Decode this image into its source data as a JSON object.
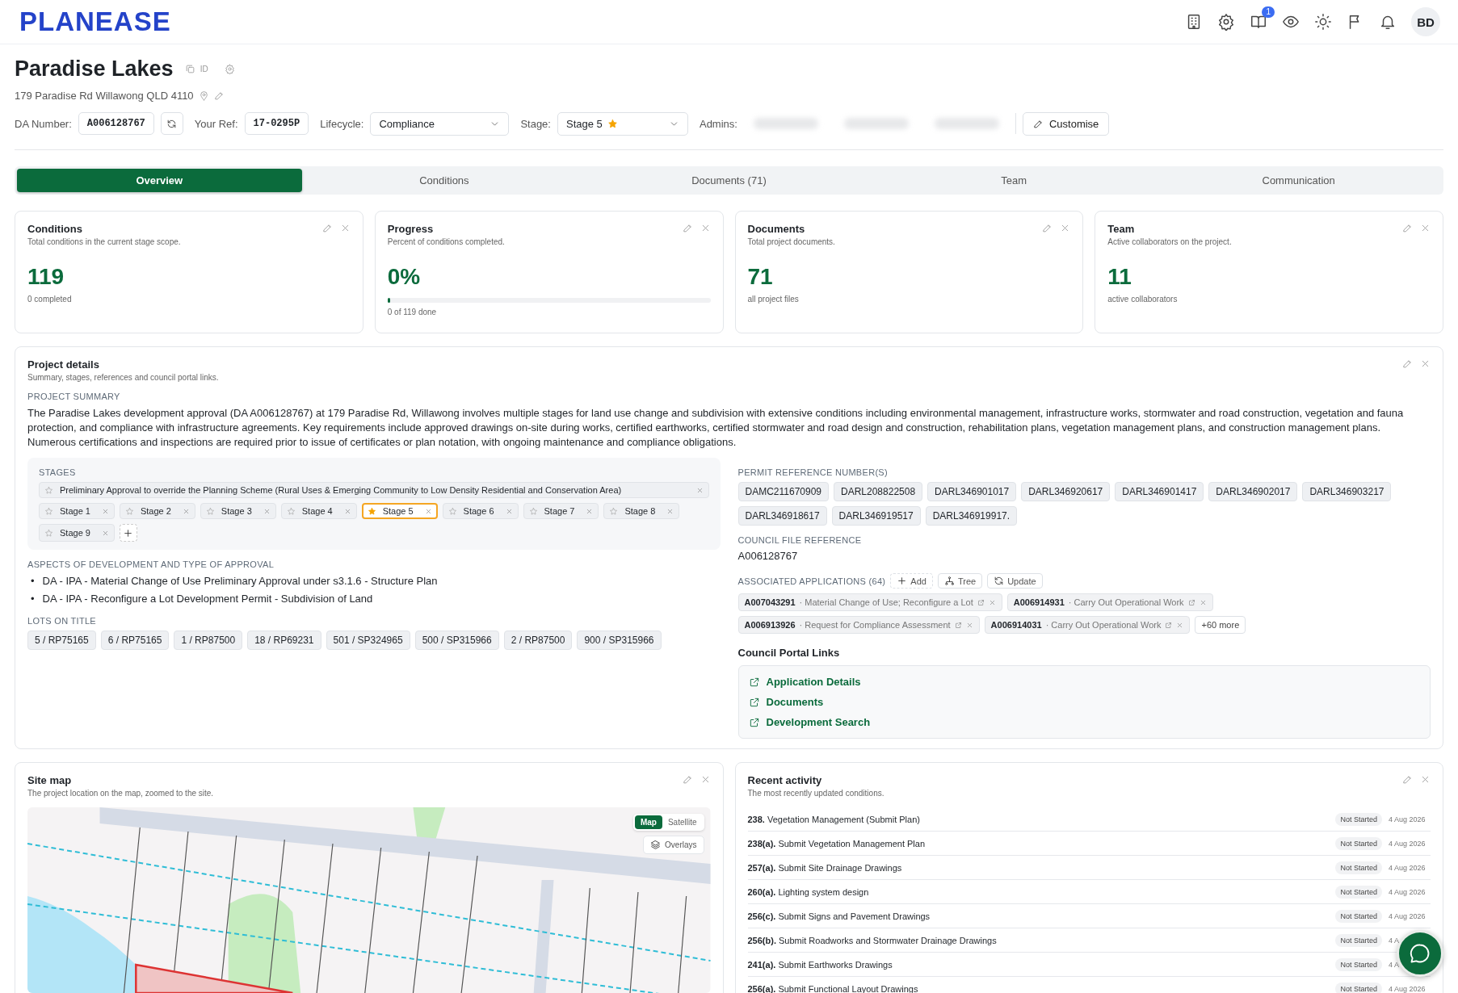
{
  "header": {
    "logo": "PLANEASE",
    "icons": [
      {
        "kind": "building"
      },
      {
        "kind": "settings"
      },
      {
        "kind": "book",
        "badge": "1"
      },
      {
        "kind": "eye"
      },
      {
        "kind": "sun"
      },
      {
        "kind": "flag"
      },
      {
        "kind": "bell"
      }
    ],
    "avatar": "BD"
  },
  "project": {
    "title": "Paradise Lakes",
    "id_label": "ID",
    "address": "179 Paradise Rd Willawong QLD 4110"
  },
  "toolbar": {
    "da_label": "DA Number:",
    "da_value": "A006128767",
    "ref_label": "Your Ref:",
    "ref_value": "17-0295P",
    "lifecycle_label": "Lifecycle:",
    "lifecycle_value": "Compliance",
    "stage_label": "Stage:",
    "stage_value": "Stage 5",
    "admins_label": "Admins:",
    "admins": [
      {
        "kind": "redacted"
      },
      {
        "kind": "redacted"
      },
      {
        "kind": "redacted"
      }
    ],
    "customise": "Customise"
  },
  "tabs": [
    {
      "label": "Overview",
      "selected": true
    },
    {
      "label": "Conditions",
      "selected": false
    },
    {
      "label": "Documents (71)",
      "selected": false
    },
    {
      "label": "Team",
      "selected": false
    },
    {
      "label": "Communication",
      "selected": false
    }
  ],
  "stat_cards": [
    {
      "title": "Conditions",
      "subtitle": "Total conditions in the current stage scope.",
      "value": "119",
      "caption": "0 completed"
    },
    {
      "title": "Progress",
      "subtitle": "Percent of conditions completed.",
      "value": "0%",
      "caption": "0 of 119 done",
      "level": 0
    },
    {
      "title": "Documents",
      "subtitle": "Total project documents.",
      "value": "71",
      "caption": "all project files"
    },
    {
      "title": "Team",
      "subtitle": "Active collaborators on the project.",
      "value": "11",
      "caption": "active collaborators"
    }
  ],
  "project_details": {
    "title": "Project details",
    "subtitle": "Summary, stages, references and council portal links.",
    "summary_label": "PROJECT SUMMARY",
    "summary": "The Paradise Lakes development approval (DA A006128767) at 179 Paradise Rd, Willawong involves multiple stages for land use change and subdivision with extensive conditions including environmental management, infrastructure works, stormwater and road construction, vegetation and fauna protection, and compliance with infrastructure agreements. Key requirements include approved drawings on-site during works, certified earthworks, certified stormwater and road design and construction, rehabilitation plans, vegetation management plans, and construction management plans. Numerous certifications and inspections are required prior to issue of certificates or plan notation, with ongoing maintenance and compliance obligations.",
    "stages_label": "STAGES",
    "stages": [
      {
        "label": "Preliminary Approval to override the Planning Scheme (Rural Uses & Emerging Community to Low Density Residential and Conservation Area)",
        "selected": false
      },
      {
        "label": "Stage 1",
        "selected": false
      },
      {
        "label": "Stage 2",
        "selected": false
      },
      {
        "label": "Stage 3",
        "selected": false
      },
      {
        "label": "Stage 4",
        "selected": false
      },
      {
        "label": "Stage 5",
        "selected": true
      },
      {
        "label": "Stage 6",
        "selected": false
      },
      {
        "label": "Stage 7",
        "selected": false
      },
      {
        "label": "Stage 8",
        "selected": false
      },
      {
        "label": "Stage 9",
        "selected": false
      }
    ],
    "aspects_label": "ASPECTS OF DEVELOPMENT AND TYPE OF APPROVAL",
    "aspects": [
      {
        "bullet": "•",
        "text": "DA - IPA - Material Change of Use Preliminary Approval under s3.1.6 - Structure Plan"
      },
      {
        "bullet": "•",
        "text": "DA - IPA - Reconfigure a Lot Development Permit - Subdivision of Land"
      }
    ],
    "lots_label": "LOTS ON TITLE",
    "lots": [
      "5 / RP75165",
      "6 / RP75165",
      "1 / RP87500",
      "18 / RP69231",
      "501 / SP324965",
      "500 / SP315966",
      "2 / RP87500",
      "900 / SP315966"
    ],
    "permits_label": "PERMIT REFERENCE NUMBER(S)",
    "permits": [
      "DAMC211670909",
      "DARL208822508",
      "DARL346901017",
      "DARL346920617",
      "DARL346901417",
      "DARL346902017",
      "DARL346903217",
      "DARL346918617",
      "DARL346919517",
      "DARL346919917."
    ],
    "file_ref_label": "COUNCIL FILE REFERENCE",
    "file_ref": "A006128767",
    "assoc_label": "ASSOCIATED APPLICATIONS (64)",
    "assoc_buttons": [
      {
        "kind": "add",
        "label": "Add"
      },
      {
        "kind": "tree",
        "label": "Tree"
      },
      {
        "kind": "update",
        "label": "Update"
      }
    ],
    "applications": [
      {
        "number": "A007043291",
        "description": "· Material Change of Use; Reconfigure a Lot"
      },
      {
        "number": "A006914931",
        "description": "· Carry Out Operational Work"
      },
      {
        "number": "A006913926",
        "description": "· Request for Compliance Assessment"
      },
      {
        "number": "A006914031",
        "description": "· Carry Out Operational Work"
      }
    ],
    "more": "+60 more",
    "portal_title": "Council Portal Links",
    "portal_links": [
      "Application Details",
      "Documents",
      "Development Search"
    ]
  },
  "site_map": {
    "title": "Site map",
    "subtitle": "The project location on the map, zoomed to the site.",
    "modes": [
      {
        "label": "Map",
        "selected": true
      },
      {
        "label": "Satellite",
        "selected": false
      }
    ],
    "overlays": "Overlays"
  },
  "recent_activity": {
    "title": "Recent activity",
    "subtitle": "The most recently updated conditions.",
    "rows": [
      {
        "number": "238.",
        "title": "Vegetation Management (Submit Plan)",
        "status": "Not Started",
        "date": "4 Aug 2026"
      },
      {
        "number": "238(a).",
        "title": "Submit Vegetation Management Plan",
        "status": "Not Started",
        "date": "4 Aug 2026"
      },
      {
        "number": "257(a).",
        "title": "Submit Site Drainage Drawings",
        "status": "Not Started",
        "date": "4 Aug 2026"
      },
      {
        "number": "260(a).",
        "title": "Lighting system design",
        "status": "Not Started",
        "date": "4 Aug 2026"
      },
      {
        "number": "256(c).",
        "title": "Submit Signs and Pavement Drawings",
        "status": "Not Started",
        "date": "4 Aug 2026"
      },
      {
        "number": "256(b).",
        "title": "Submit Roadworks and Stormwater Drainage Drawings",
        "status": "Not Started",
        "date": "4 A"
      },
      {
        "number": "241(a).",
        "title": "Submit Earthworks Drawings",
        "status": "Not Started",
        "date": "4 A"
      },
      {
        "number": "256(a).",
        "title": "Submit Functional Layout Drawings",
        "status": "Not Started",
        "date": "4 Aug 2026"
      }
    ]
  }
}
